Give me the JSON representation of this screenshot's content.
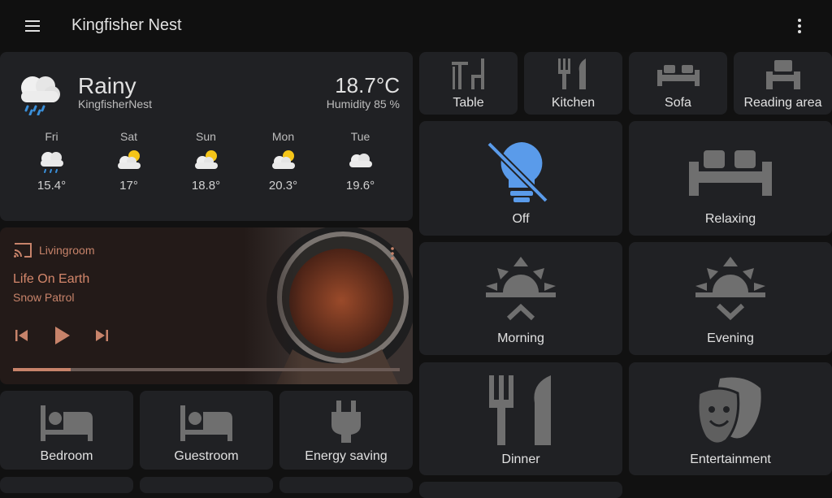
{
  "header": {
    "title": "Kingfisher Nest",
    "menu_icon": "hamburger-icon",
    "more_icon": "dots-vertical-icon"
  },
  "weather": {
    "condition": "Rainy",
    "name": "KingfisherNest",
    "temperature": "18.7°C",
    "humidity": "Humidity 85 %",
    "icon": "rainy-icon",
    "forecast": [
      {
        "day": "Fri",
        "temp": "15.4°",
        "icon": "rainy-icon"
      },
      {
        "day": "Sat",
        "temp": "17°",
        "icon": "partly-cloudy-icon"
      },
      {
        "day": "Sun",
        "temp": "18.8°",
        "icon": "partly-cloudy-icon"
      },
      {
        "day": "Mon",
        "temp": "20.3°",
        "icon": "partly-cloudy-icon"
      },
      {
        "day": "Tue",
        "temp": "19.6°",
        "icon": "cloudy-icon"
      }
    ]
  },
  "media": {
    "source": "Livingroom",
    "title": "Life On Earth",
    "artist": "Snow Patrol",
    "progress": 0.15,
    "accent": "#c7836a"
  },
  "tiles": {
    "table": "Table",
    "kitchen": "Kitchen",
    "sofa": "Sofa",
    "reading": "Reading area",
    "light": "Off",
    "relaxing": "Relaxing",
    "morning": "Morning",
    "evening": "Evening",
    "bedroom": "Bedroom",
    "guestroom": "Guestroom",
    "energy": "Energy saving",
    "dinner": "Dinner",
    "entertainment": "Entertainment"
  },
  "colors": {
    "icon_grey": "#6f6f6f",
    "light_blue": "#5a9bea",
    "card_bg": "#202124"
  }
}
